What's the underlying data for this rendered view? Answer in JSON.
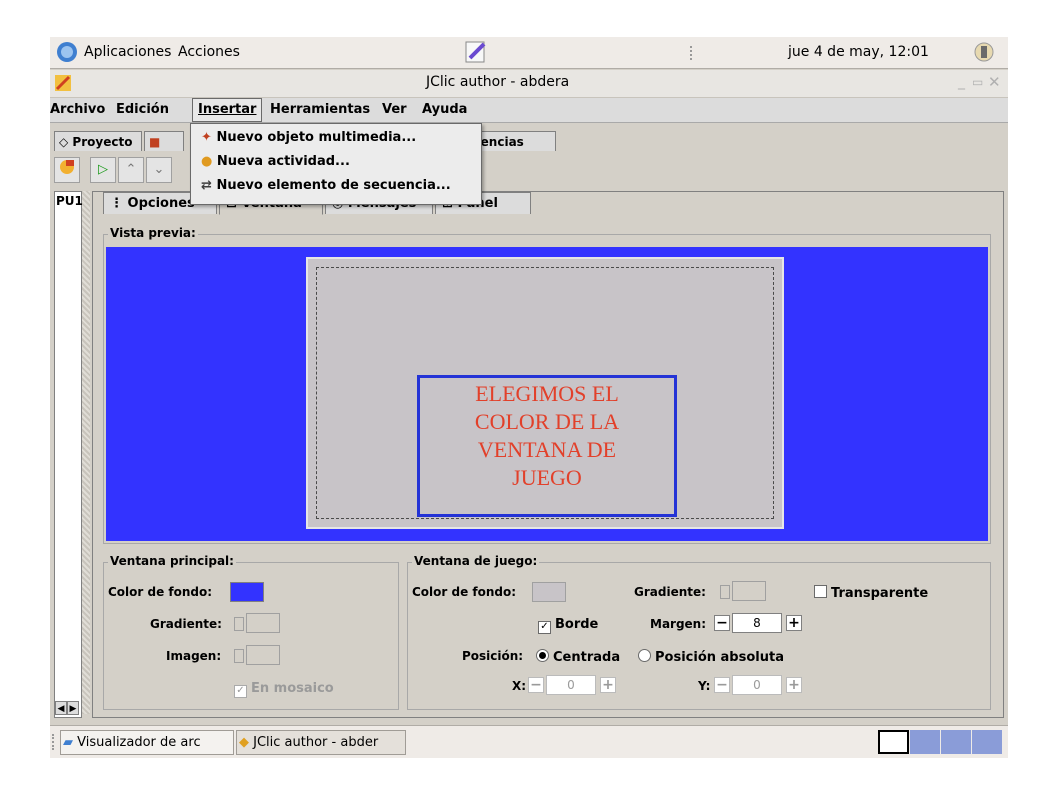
{
  "top_panel": {
    "apps_label": "Aplicaciones",
    "actions_label": "Acciones",
    "clock": "jue  4 de may, 12:01"
  },
  "window": {
    "title": "JClic author - abdera"
  },
  "menubar": {
    "items": [
      "Archivo",
      "Edición",
      "Insertar",
      "Herramientas",
      "Ver",
      "Ayuda"
    ]
  },
  "tabs": {
    "proyecto": "Proyecto",
    "secuencias": "cuencias"
  },
  "dropdown": {
    "items": [
      "Nuevo objeto multimedia...",
      "Nueva actividad...",
      "Nuevo elemento de secuencia..."
    ]
  },
  "left_list": {
    "item": "PU1"
  },
  "subtabs": [
    "Opciones",
    "Ventana",
    "Mensajes",
    "Panel"
  ],
  "preview": {
    "label": "Vista previa:",
    "annotation_lines": [
      "ELEGIMOS EL",
      "COLOR DE LA",
      "VENTANA DE",
      "JUEGO"
    ],
    "outer_color": "#3333ff",
    "inner_color": "#c8c4c8"
  },
  "ventana_principal": {
    "label": "Ventana principal:",
    "color_fondo_label": "Color de fondo:",
    "gradiente_label": "Gradiente:",
    "imagen_label": "Imagen:",
    "mosaico_label": "En mosaico",
    "color_fondo": "#3333ff"
  },
  "ventana_juego": {
    "label": "Ventana de juego:",
    "color_fondo_label": "Color de fondo:",
    "gradiente_label": "Gradiente:",
    "transparente_label": "Transparente",
    "borde_label": "Borde",
    "margen_label": "Margen:",
    "margen_value": "8",
    "posicion_label": "Posición:",
    "centrada_label": "Centrada",
    "absoluta_label": "Posición absoluta",
    "x_label": "X:",
    "x_value": "0",
    "y_label": "Y:",
    "y_value": "0"
  },
  "taskbar": {
    "tasks": [
      "Visualizador de arc",
      "JClic author - abder"
    ]
  }
}
